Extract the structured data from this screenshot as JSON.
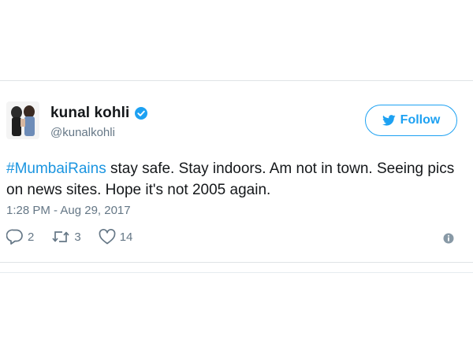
{
  "tweet": {
    "author": {
      "display_name": "kunal kohli",
      "handle": "@kunalkohli",
      "verified": true
    },
    "follow_label": "Follow",
    "hashtag": "#MumbaiRains",
    "text": " stay safe. Stay indoors. Am not in town. Seeing pics on news sites. Hope it's not 2005 again.",
    "timestamp": "1:28 PM - Aug 29, 2017",
    "stats": {
      "replies": "2",
      "retweets": "3",
      "likes": "14"
    }
  },
  "colors": {
    "accent": "#1da1f2",
    "hashtag": "#1b95e0",
    "text": "#14171a",
    "muted": "#657786",
    "border": "#dfe3e6"
  },
  "icons": {
    "verified": "verified-badge-icon",
    "follow": "bird-icon",
    "reply": "reply-icon",
    "retweet": "retweet-icon",
    "like": "heart-icon",
    "info": "info-icon"
  }
}
